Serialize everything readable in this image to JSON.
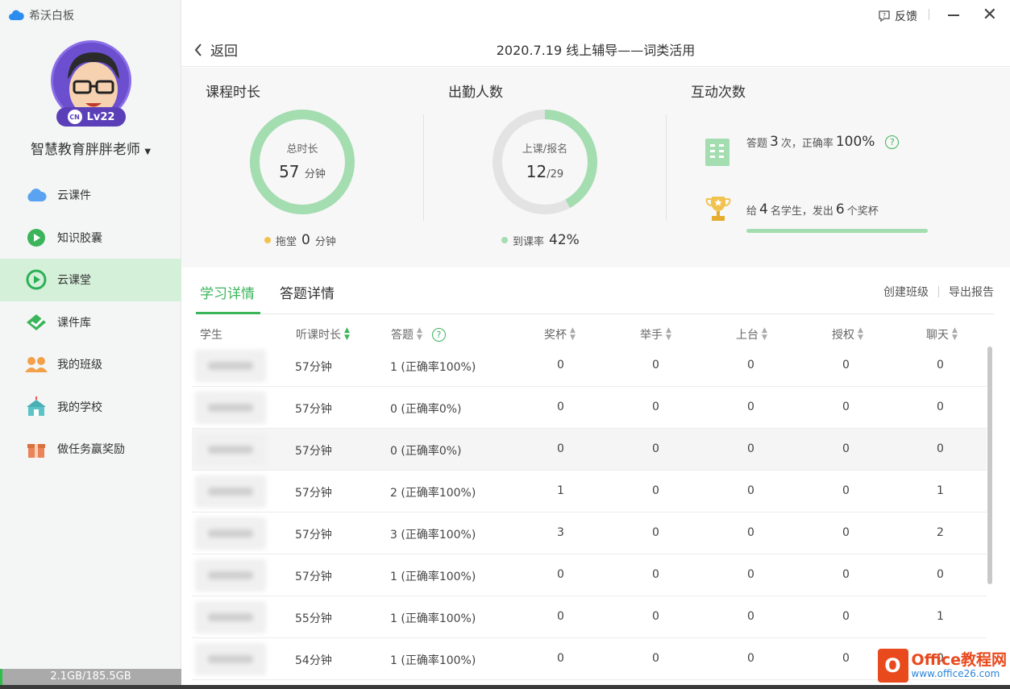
{
  "app": {
    "title": "希沃白板"
  },
  "profile": {
    "level": "Lv22",
    "badge": "CN",
    "name": "智慧教育胖胖老师"
  },
  "nav": [
    {
      "label": "云课件",
      "icon": "cloud-icon"
    },
    {
      "label": "知识胶囊",
      "icon": "capsule-icon"
    },
    {
      "label": "云课堂",
      "icon": "play-icon",
      "active": true
    },
    {
      "label": "课件库",
      "icon": "library-icon"
    },
    {
      "label": "我的班级",
      "icon": "class-icon"
    },
    {
      "label": "我的学校",
      "icon": "school-icon"
    },
    {
      "label": "做任务赢奖励",
      "icon": "gift-icon"
    }
  ],
  "storage": {
    "text": "2.1GB/185.5GB",
    "fraction": 0.011
  },
  "titlebar": {
    "feedback": "反馈"
  },
  "header": {
    "back": "返回",
    "title": "2020.7.19 线上辅导——词类活用"
  },
  "stats": {
    "duration": {
      "heading": "课程时长",
      "ring_label": "总时长",
      "value": "57",
      "unit": "分钟",
      "foot_label": "拖堂",
      "foot_value": "0",
      "foot_unit": "分钟",
      "fill": 1.0
    },
    "attendance": {
      "heading": "出勤人数",
      "ring_label": "上课/报名",
      "attended": "12",
      "sep": "/",
      "enrolled": "29",
      "foot_label": "到课率",
      "foot_value": "42%",
      "fill": 0.42
    },
    "interaction": {
      "heading": "互动次数",
      "answer_prefix": "答题",
      "answer_count": "3",
      "answer_mid": "次，正确率",
      "answer_rate": "100%",
      "trophy_prefix": "给",
      "trophy_students": "4",
      "trophy_mid": "名学生，发出",
      "trophy_count": "6",
      "trophy_suffix": "个奖杯",
      "progress": 1.0
    }
  },
  "colors": {
    "accent": "#3bb55a",
    "ring_green": "#a3ddb0",
    "ring_gray": "#e3e3e3",
    "dot_orange": "#f2c24f"
  },
  "tabs": {
    "items": [
      "学习详情",
      "答题详情"
    ],
    "active": 0,
    "create_class": "创建班级",
    "export": "导出报告"
  },
  "table": {
    "columns": [
      "学生",
      "听课时长",
      "答题",
      "奖杯",
      "举手",
      "上台",
      "授权",
      "聊天"
    ],
    "rows": [
      [
        "",
        "57分钟",
        "1 (正确率100%)",
        "0",
        "0",
        "0",
        "0",
        "0"
      ],
      [
        "",
        "57分钟",
        "0 (正确率0%)",
        "0",
        "0",
        "0",
        "0",
        "0"
      ],
      [
        "",
        "57分钟",
        "0 (正确率0%)",
        "0",
        "0",
        "0",
        "0",
        "0"
      ],
      [
        "",
        "57分钟",
        "2 (正确率100%)",
        "1",
        "0",
        "0",
        "0",
        "1"
      ],
      [
        "",
        "57分钟",
        "3 (正确率100%)",
        "3",
        "0",
        "0",
        "0",
        "2"
      ],
      [
        "",
        "57分钟",
        "1 (正确率100%)",
        "0",
        "0",
        "0",
        "0",
        "0"
      ],
      [
        "",
        "55分钟",
        "1 (正确率100%)",
        "0",
        "0",
        "0",
        "0",
        "1"
      ],
      [
        "",
        "54分钟",
        "1 (正确率100%)",
        "0",
        "0",
        "0",
        "0",
        "0"
      ]
    ]
  },
  "watermark": {
    "main": "Office教程网",
    "sub": "www.office26.com"
  }
}
